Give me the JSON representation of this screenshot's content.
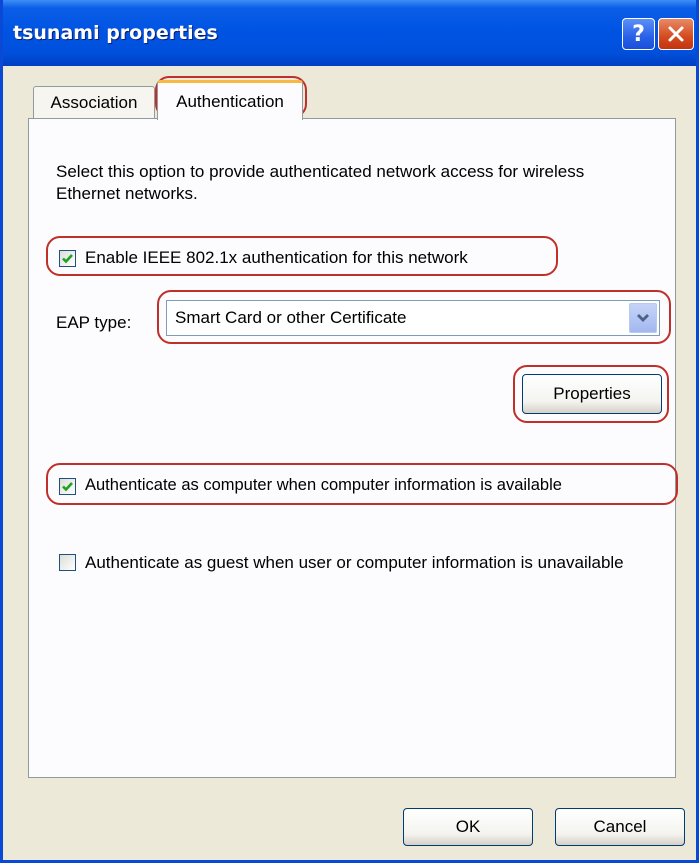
{
  "window": {
    "title": "tsunami properties",
    "help_glyph": "?"
  },
  "tabs": [
    {
      "label": "Association",
      "active": false
    },
    {
      "label": "Authentication",
      "active": true
    }
  ],
  "authentication": {
    "description": "Select this option to provide authenticated network access for wireless Ethernet networks.",
    "enable_8021x": {
      "label": "Enable IEEE 802.1x authentication for this network",
      "checked": true
    },
    "eap_type_label": "EAP type:",
    "eap_type_value": "Smart Card or other Certificate",
    "properties_button": "Properties",
    "auth_as_computer": {
      "label": "Authenticate as computer when computer information is available",
      "checked": true
    },
    "auth_as_guest": {
      "label": "Authenticate as guest when user or computer information is unavailable",
      "checked": false
    }
  },
  "footer": {
    "ok_label": "OK",
    "cancel_label": "Cancel"
  },
  "icons": {
    "help": "help-icon",
    "close": "close-icon",
    "dropdown": "chevron-down-icon",
    "check": "checkmark-icon"
  },
  "colors": {
    "titlebar": "#0054e3",
    "highlight": "#c0302a",
    "check": "#21a121",
    "tab_accent": "#f7b944"
  }
}
